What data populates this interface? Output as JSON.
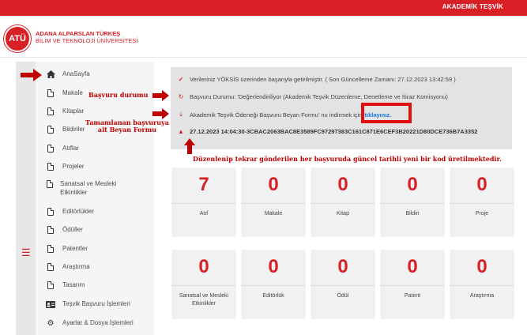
{
  "topbar": {
    "link_label": "AKADEMİK TEŞVİK",
    "accent": "#d81f26"
  },
  "logo": {
    "text": "ATÜ",
    "line1": "ADANA ALPARSLAN TÜRKEŞ",
    "line2": "BİLİM VE TEKNOLOJİ ÜNİVERSİTESİ"
  },
  "sidebar": {
    "items": [
      {
        "label": "AnaSayfa",
        "icon": "home-icon"
      },
      {
        "label": "Makale",
        "icon": "document-icon"
      },
      {
        "label": "Kitaplar",
        "icon": "document-icon"
      },
      {
        "label": "Bildiriler",
        "icon": "document-icon"
      },
      {
        "label": "Atıflar",
        "icon": "document-icon"
      },
      {
        "label": "Projeler",
        "icon": "document-icon"
      },
      {
        "label": "Sanatsal ve Mesleki Etkinlikler",
        "icon": "document-icon"
      },
      {
        "label": "Editörlükler",
        "icon": "document-icon"
      },
      {
        "label": "Ödüller",
        "icon": "document-icon"
      },
      {
        "label": "Patentler",
        "icon": "document-icon"
      },
      {
        "label": "Araştırma",
        "icon": "document-icon"
      },
      {
        "label": "Tasarım",
        "icon": "document-icon"
      },
      {
        "label": "Teşvik Başvuru İşlemleri",
        "icon": "id-card-icon"
      },
      {
        "label": "Ayarlar & Dosya İşlemleri",
        "icon": "gears-icon"
      }
    ]
  },
  "status": {
    "yoksis_msg": "Verileriniz YÖKSİS üzerinden başarıyla getirilmiştir. ( Son Güncelleme Zamanı: 27.12.2023 13:42:59 )",
    "application_status": "Başvuru Durumu: 'Değerlendiriliyor (Akademik Teşvik Düzenleme, Denetleme ve İtiraz Komisyonu)",
    "download_prefix": "Akademik Teşvik Ödeneği Başvuru Beyan Formu' nu indirmek için",
    "download_link": "tıklayınız.",
    "code_line": "27.12.2023 14:04:30-3CBAC2063BAC8E3589FC97297383C161C871E6CEF3B20221D80DCE736B7A3352"
  },
  "annotations": {
    "status_label": "Başvuru durumu",
    "form_label_1": "Tamamlanan başvuruya",
    "form_label_2": "ait Beyan Formu",
    "code_note": "Düzenlenip tekrar gönderilen her başvuruda güncel tarihli yeni bir kod üretilmektedir.",
    "color": "#c00000"
  },
  "cards": [
    {
      "value": "7",
      "label": "Atıf"
    },
    {
      "value": "0",
      "label": "Makale"
    },
    {
      "value": "0",
      "label": "Kitap"
    },
    {
      "value": "0",
      "label": "Bildiri"
    },
    {
      "value": "0",
      "label": "Proje"
    },
    {
      "value": "0",
      "label": "Sanatsal ve Mesleki Etkinlikler"
    },
    {
      "value": "0",
      "label": "Editörlük"
    },
    {
      "value": "0",
      "label": "Ödül"
    },
    {
      "value": "0",
      "label": "Patent"
    },
    {
      "value": "0",
      "label": "Araştırma"
    }
  ]
}
